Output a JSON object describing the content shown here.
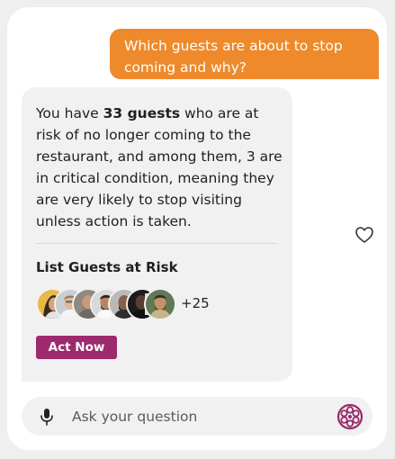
{
  "user_message": {
    "text": "Which guests are about to stop coming and why?"
  },
  "bot_message": {
    "text_before": "You have ",
    "highlight": "33 guests",
    "text_after": " who are at risk of no longer coming to the restaurant, and among them, 3 are in critical condition, meaning they are very likely to stop visiting unless action is taken.",
    "list_title": "List Guests at Risk",
    "avatars": [
      "guest-avatar-1",
      "guest-avatar-2",
      "guest-avatar-3",
      "guest-avatar-4",
      "guest-avatar-5",
      "guest-avatar-6",
      "guest-avatar-7"
    ],
    "more_count": "+25",
    "action_label": "Act Now"
  },
  "input": {
    "placeholder": "Ask your question"
  },
  "icons": {
    "favorite": "heart-icon",
    "voice": "microphone-icon",
    "brand": "film-reel-icon"
  },
  "colors": {
    "user_bubble": "#ee8a2b",
    "action_button": "#9c2a6c",
    "brand_icon": "#9c2a6c",
    "bubble_bg": "#f1f1f1"
  }
}
